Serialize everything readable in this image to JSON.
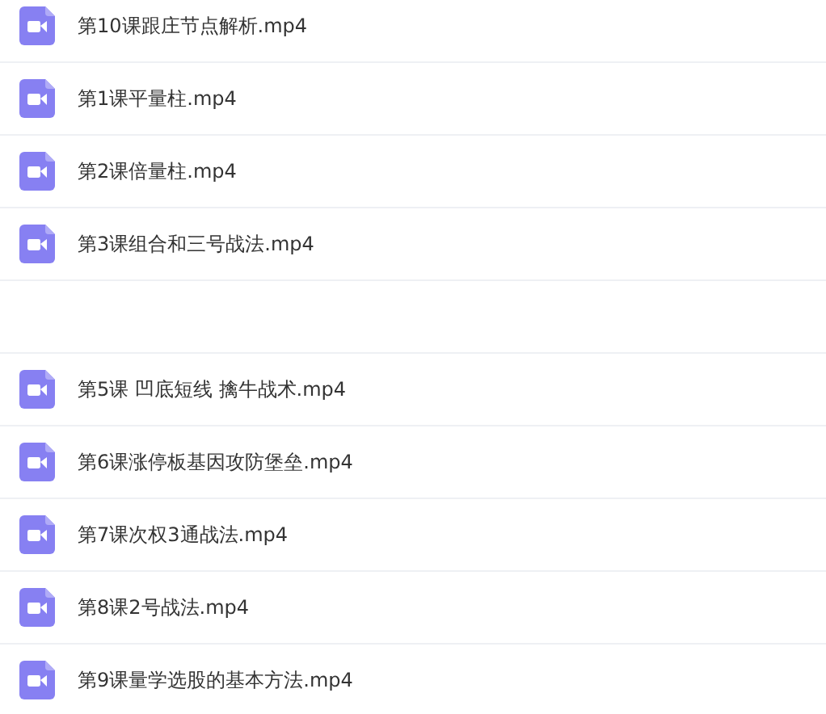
{
  "files": [
    {
      "kind": "video",
      "name": "第10课跟庄节点解析.mp4"
    },
    {
      "kind": "video",
      "name": "第1课平量柱.mp4"
    },
    {
      "kind": "video",
      "name": "第2课倍量柱.mp4"
    },
    {
      "kind": "video",
      "name": "第3课组合和三号战法.mp4"
    },
    {
      "kind": "hidden"
    },
    {
      "kind": "video",
      "name": "第5课 凹底短线 擒牛战术.mp4"
    },
    {
      "kind": "video",
      "name": "第6课涨停板基因攻防堡垒.mp4"
    },
    {
      "kind": "video",
      "name": "第7课次权3通战法.mp4"
    },
    {
      "kind": "video",
      "name": "第8课2号战法.mp4"
    },
    {
      "kind": "video",
      "name": "第9课量学选股的基本方法.mp4"
    }
  ]
}
